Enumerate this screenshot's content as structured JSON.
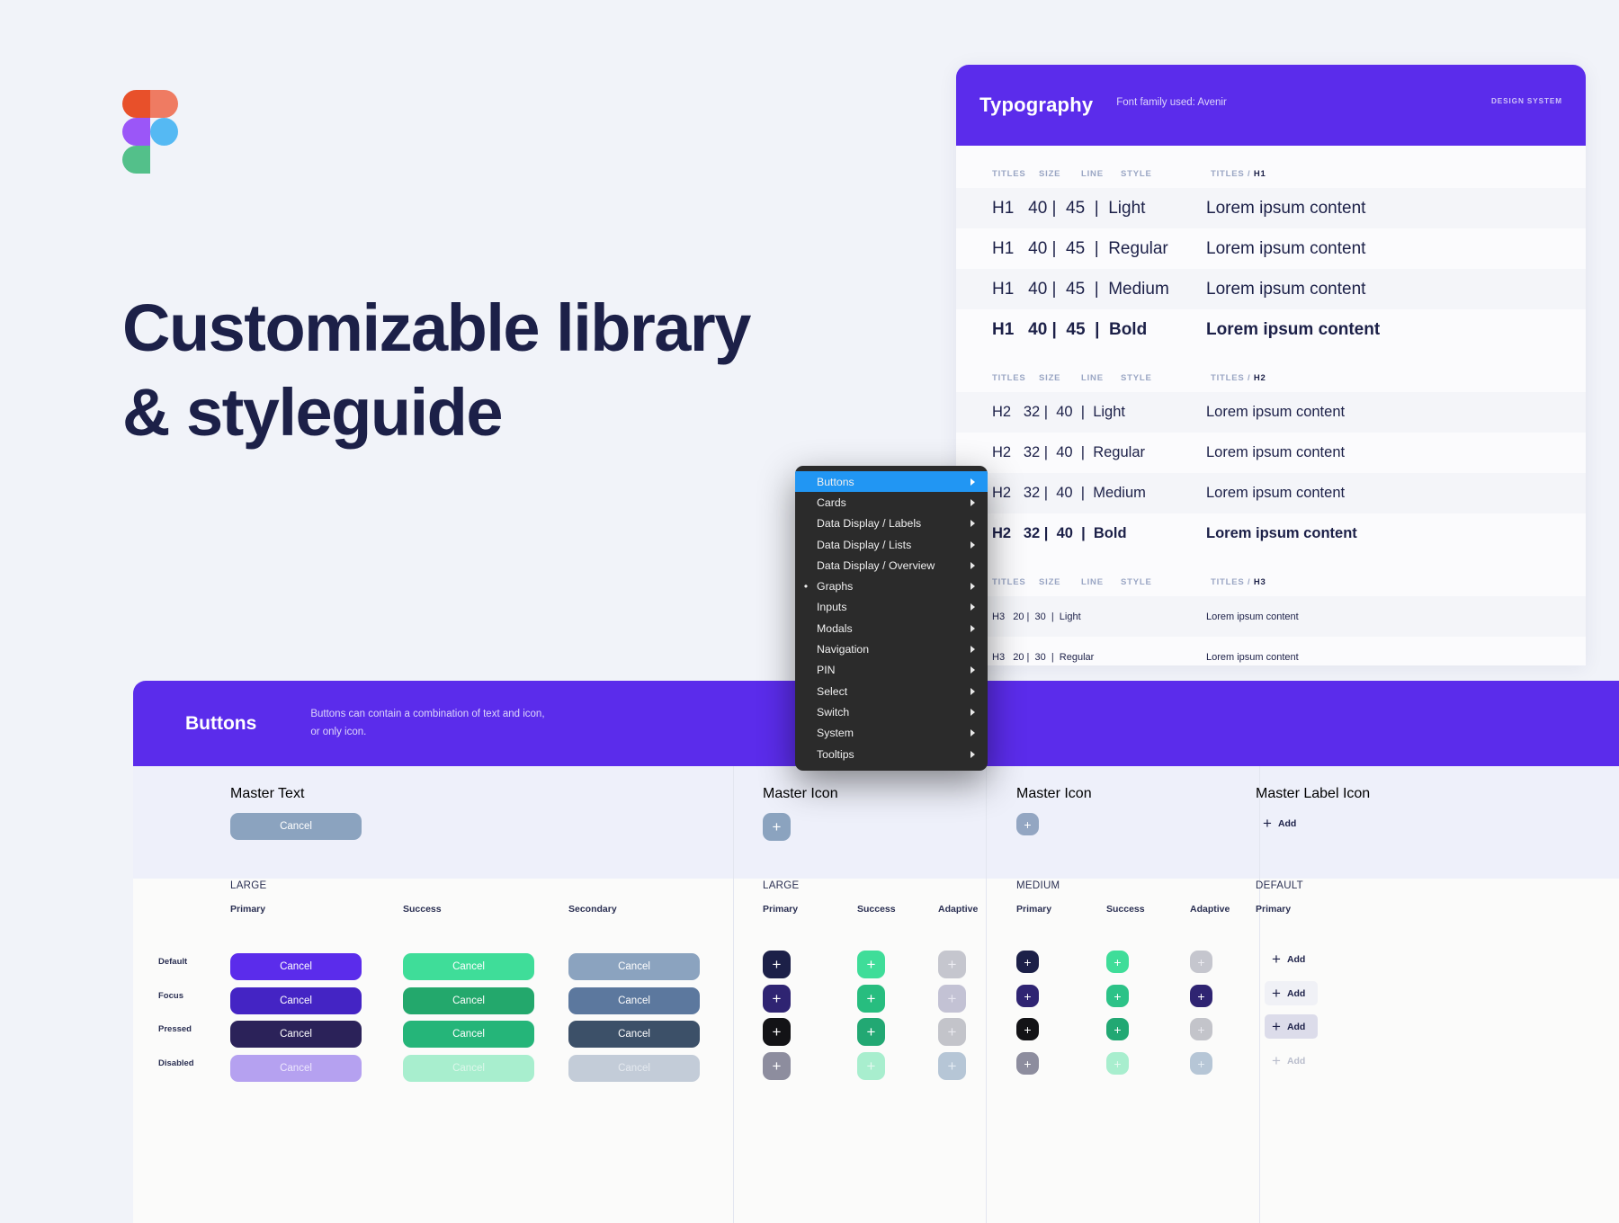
{
  "brand": {
    "logo_icon": "figma-logo",
    "headline_line1": "Customizable library",
    "headline_line2": "& styleguide"
  },
  "typography": {
    "title": "Typography",
    "subtitle": "Font family used: Avenir",
    "tag": "DESIGN SYSTEM",
    "columns": {
      "titles": "TITLES",
      "size": "SIZE",
      "line": "LINE",
      "style": "STYLE"
    },
    "sections": [
      {
        "sample_header_prefix": "TITLES /",
        "sample_header_level": "H1",
        "rows": [
          {
            "spec": "H1   40 |  45  |  Light",
            "sample": "Lorem ipsum content",
            "weight": "w-light"
          },
          {
            "spec": "H1   40 |  45  |  Regular",
            "sample": "Lorem ipsum content",
            "weight": "w-regular"
          },
          {
            "spec": "H1   40 |  45  |  Medium",
            "sample": "Lorem ipsum content",
            "weight": "w-medium"
          },
          {
            "spec": "H1   40 |  45  |  Bold",
            "sample": "Lorem ipsum content",
            "weight": "w-bold"
          }
        ]
      },
      {
        "sample_header_prefix": "TITLES /",
        "sample_header_level": "H2",
        "rows": [
          {
            "spec": "H2   32 |  40  |  Light",
            "sample": "Lorem ipsum content",
            "weight": "w-light"
          },
          {
            "spec": "H2   32 |  40  |  Regular",
            "sample": "Lorem ipsum content",
            "weight": "w-regular"
          },
          {
            "spec": "H2   32 |  40  |  Medium",
            "sample": "Lorem ipsum content",
            "weight": "w-medium"
          },
          {
            "spec": "H2   32 |  40  |  Bold",
            "sample": "Lorem ipsum content",
            "weight": "w-bold"
          }
        ]
      },
      {
        "sample_header_prefix": "TITLES /",
        "sample_header_level": "H3",
        "rows": [
          {
            "spec": "H3   20 |  30  |  Light",
            "sample": "Lorem ipsum content",
            "weight": "w-light"
          },
          {
            "spec": "H3   20 |  30  |  Regular",
            "sample": "Lorem ipsum content",
            "weight": "w-regular"
          }
        ]
      }
    ]
  },
  "context_menu": {
    "selected": "Buttons",
    "marked": "Graphs",
    "items": [
      {
        "label": "Buttons",
        "active": true,
        "marked": false
      },
      {
        "label": "Cards",
        "active": false,
        "marked": false
      },
      {
        "label": "Data Display / Labels",
        "active": false,
        "marked": false
      },
      {
        "label": "Data Display / Lists",
        "active": false,
        "marked": false
      },
      {
        "label": "Data Display / Overview",
        "active": false,
        "marked": false
      },
      {
        "label": "Graphs",
        "active": false,
        "marked": true
      },
      {
        "label": "Inputs",
        "active": false,
        "marked": false
      },
      {
        "label": "Modals",
        "active": false,
        "marked": false
      },
      {
        "label": "Navigation",
        "active": false,
        "marked": false
      },
      {
        "label": "PIN",
        "active": false,
        "marked": false
      },
      {
        "label": "Select",
        "active": false,
        "marked": false
      },
      {
        "label": "Switch",
        "active": false,
        "marked": false
      },
      {
        "label": "System",
        "active": false,
        "marked": false
      },
      {
        "label": "Tooltips",
        "active": false,
        "marked": false
      }
    ]
  },
  "buttons_panel": {
    "title": "Buttons",
    "description_line1": "Buttons can contain a combination of text and icon,",
    "description_line2": "or only icon.",
    "state_labels": [
      "Default",
      "Focus",
      "Pressed",
      "Disabled"
    ],
    "text_section": {
      "master_label": "Master Text",
      "master_button_label": "Cancel",
      "size_label": "LARGE",
      "columns": [
        {
          "title": "Primary",
          "buttons": [
            {
              "label": "Cancel",
              "bg": "#5b2ceb",
              "fg": "#ffffff"
            },
            {
              "label": "Cancel",
              "bg": "#4424c4",
              "fg": "#ffffff"
            },
            {
              "label": "Cancel",
              "bg": "#2b2259",
              "fg": "#ffffff"
            },
            {
              "label": "Cancel",
              "bg": "#b5a1f0",
              "fg": "#ede7fd"
            }
          ]
        },
        {
          "title": "Success",
          "buttons": [
            {
              "label": "Cancel",
              "bg": "#3fdd99",
              "fg": "#ffffff"
            },
            {
              "label": "Cancel",
              "bg": "#23a86c",
              "fg": "#ffffff"
            },
            {
              "label": "Cancel",
              "bg": "#25b579",
              "fg": "#ffffff"
            },
            {
              "label": "Cancel",
              "bg": "#a8eece",
              "fg": "#dcf7ea"
            }
          ]
        },
        {
          "title": "Secondary",
          "buttons": [
            {
              "label": "Cancel",
              "bg": "#8ba3bf",
              "fg": "#ffffff"
            },
            {
              "label": "Cancel",
              "bg": "#5c789e",
              "fg": "#ffffff"
            },
            {
              "label": "Cancel",
              "bg": "#3c5068",
              "fg": "#ffffff"
            },
            {
              "label": "Cancel",
              "bg": "#c3ccd8",
              "fg": "#e4e9ef"
            }
          ]
        }
      ]
    },
    "icon_large_section": {
      "master_label": "Master Icon",
      "size_label": "LARGE",
      "icon": "plus-icon",
      "columns": [
        {
          "title": "Primary",
          "buttons": [
            {
              "bg": "#1c2048",
              "fg": "#ffffff"
            },
            {
              "bg": "#2f2472",
              "fg": "#ffffff"
            },
            {
              "bg": "#131316",
              "fg": "#ffffff"
            },
            {
              "bg": "#8d8d9e",
              "fg": "#ffffff"
            }
          ]
        },
        {
          "title": "Success",
          "buttons": [
            {
              "bg": "#3fdd99",
              "fg": "#ffffff"
            },
            {
              "bg": "#27bd7f",
              "fg": "#ffffff"
            },
            {
              "bg": "#22a873",
              "fg": "#ffffff"
            },
            {
              "bg": "#a8eece",
              "fg": "#e3f9ef"
            }
          ]
        },
        {
          "title": "Adaptive",
          "buttons": [
            {
              "bg": "#c5c6ce",
              "fg": "#ececf2"
            },
            {
              "bg": "#c3c2d4",
              "fg": "#e6e5ef"
            },
            {
              "bg": "#c3c4ca",
              "fg": "#e8e8ee"
            },
            {
              "bg": "#b6c6d6",
              "fg": "#e4ecf3"
            }
          ]
        }
      ]
    },
    "icon_medium_section": {
      "master_label": "Master Icon",
      "size_label": "MEDIUM",
      "icon": "plus-icon",
      "columns": [
        {
          "title": "Primary",
          "buttons": [
            {
              "bg": "#1c2048",
              "fg": "#ffffff"
            },
            {
              "bg": "#2f2472",
              "fg": "#ffffff"
            },
            {
              "bg": "#131316",
              "fg": "#ffffff"
            },
            {
              "bg": "#8d8d9e",
              "fg": "#ffffff"
            }
          ]
        },
        {
          "title": "Success",
          "buttons": [
            {
              "bg": "#3fdd99",
              "fg": "#ffffff"
            },
            {
              "bg": "#2cc287",
              "fg": "#ffffff"
            },
            {
              "bg": "#22a873",
              "fg": "#ffffff"
            },
            {
              "bg": "#a8eece",
              "fg": "#e3f9ef"
            }
          ]
        },
        {
          "title": "Adaptive",
          "buttons": [
            {
              "bg": "#c5c6ce",
              "fg": "#ececf2"
            },
            {
              "bg": "#2f2472",
              "fg": "#ffffff"
            },
            {
              "bg": "#c3c4ca",
              "fg": "#e8e8ee"
            },
            {
              "bg": "#b6c6d6",
              "fg": "#e4ecf3"
            }
          ]
        }
      ]
    },
    "label_icon_section": {
      "master_label": "Master Label Icon",
      "master_button_label": "Add",
      "size_label": "DEFAULT",
      "icon": "plus-icon",
      "columns": [
        {
          "title": "Primary",
          "buttons": [
            {
              "label": "Add",
              "bg": "transparent",
              "fg": "#1c2048"
            },
            {
              "label": "Add",
              "bg": "#f0f1f6",
              "fg": "#1c2048"
            },
            {
              "label": "Add",
              "bg": "#dcdcea",
              "fg": "#1c2048"
            },
            {
              "label": "Add",
              "bg": "transparent",
              "fg": "#b9bdcc"
            }
          ]
        }
      ]
    }
  }
}
